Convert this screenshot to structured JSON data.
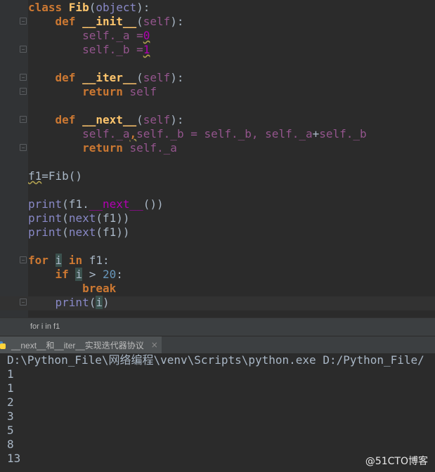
{
  "editor": {
    "lines": [
      [
        {
          "t": "class ",
          "c": "kw"
        },
        {
          "t": "Fib",
          "c": "fn"
        },
        {
          "t": "(",
          "c": "plain"
        },
        {
          "t": "object",
          "c": "builtin"
        },
        {
          "t": "):",
          "c": "plain"
        }
      ],
      [
        {
          "t": "    "
        },
        {
          "t": "def ",
          "c": "kw"
        },
        {
          "t": "__init__",
          "c": "fn"
        },
        {
          "t": "(",
          "c": "plain"
        },
        {
          "t": "self",
          "c": "selfc"
        },
        {
          "t": "):",
          "c": "plain"
        }
      ],
      [
        {
          "t": "        "
        },
        {
          "t": "self",
          "c": "selfc"
        },
        {
          "t": "._a =",
          "c": "selfc"
        },
        {
          "t": "0",
          "c": "mag wavy"
        }
      ],
      [
        {
          "t": "        "
        },
        {
          "t": "self",
          "c": "selfc"
        },
        {
          "t": "._b =",
          "c": "selfc"
        },
        {
          "t": "1",
          "c": "mag wavy"
        }
      ],
      [
        {
          "t": ""
        }
      ],
      [
        {
          "t": "    "
        },
        {
          "t": "def ",
          "c": "kw"
        },
        {
          "t": "__iter__",
          "c": "fn"
        },
        {
          "t": "(",
          "c": "plain"
        },
        {
          "t": "self",
          "c": "selfc"
        },
        {
          "t": "):",
          "c": "plain"
        }
      ],
      [
        {
          "t": "        "
        },
        {
          "t": "return ",
          "c": "kw"
        },
        {
          "t": "self",
          "c": "selfc"
        }
      ],
      [
        {
          "t": ""
        }
      ],
      [
        {
          "t": "    "
        },
        {
          "t": "def ",
          "c": "kw"
        },
        {
          "t": "__next__",
          "c": "fn"
        },
        {
          "t": "(",
          "c": "plain"
        },
        {
          "t": "self",
          "c": "selfc"
        },
        {
          "t": "):",
          "c": "plain"
        }
      ],
      [
        {
          "t": "        "
        },
        {
          "t": "self",
          "c": "selfc"
        },
        {
          "t": "._a",
          "c": "selfc"
        },
        {
          "t": ",",
          "c": "kw wavy"
        },
        {
          "t": "self",
          "c": "selfc"
        },
        {
          "t": "._b = ",
          "c": "selfc"
        },
        {
          "t": "self",
          "c": "selfc"
        },
        {
          "t": "._b, ",
          "c": "selfc"
        },
        {
          "t": "self",
          "c": "selfc"
        },
        {
          "t": "._a",
          "c": "selfc"
        },
        {
          "t": "+",
          "c": "plain"
        },
        {
          "t": "self",
          "c": "selfc"
        },
        {
          "t": "._b",
          "c": "selfc"
        }
      ],
      [
        {
          "t": "        "
        },
        {
          "t": "return ",
          "c": "kw"
        },
        {
          "t": "self",
          "c": "selfc"
        },
        {
          "t": "._a",
          "c": "selfc"
        }
      ],
      [
        {
          "t": ""
        }
      ],
      [
        {
          "t": "f1",
          "c": "plain wavy"
        },
        {
          "t": "=Fib()",
          "c": "plain"
        }
      ],
      [
        {
          "t": ""
        }
      ],
      [
        {
          "t": "print",
          "c": "builtin"
        },
        {
          "t": "(f1.",
          "c": "plain"
        },
        {
          "t": "__next__",
          "c": "dunder"
        },
        {
          "t": "())",
          "c": "plain"
        }
      ],
      [
        {
          "t": "print",
          "c": "builtin"
        },
        {
          "t": "(",
          "c": "plain"
        },
        {
          "t": "next",
          "c": "builtin"
        },
        {
          "t": "(f1))",
          "c": "plain"
        }
      ],
      [
        {
          "t": "print",
          "c": "builtin"
        },
        {
          "t": "(",
          "c": "plain"
        },
        {
          "t": "next",
          "c": "builtin"
        },
        {
          "t": "(f1))",
          "c": "plain"
        }
      ],
      [
        {
          "t": ""
        }
      ],
      [
        {
          "t": "for ",
          "c": "kw"
        },
        {
          "t": "i",
          "c": "plain varhl"
        },
        {
          "t": " in ",
          "c": "kw"
        },
        {
          "t": "f1:",
          "c": "plain"
        }
      ],
      [
        {
          "t": "    "
        },
        {
          "t": "if ",
          "c": "kw"
        },
        {
          "t": "i",
          "c": "plain varhl"
        },
        {
          "t": " > ",
          "c": "plain"
        },
        {
          "t": "20",
          "c": "num"
        },
        {
          "t": ":",
          "c": "plain"
        }
      ],
      [
        {
          "t": "        "
        },
        {
          "t": "break",
          "c": "kw"
        }
      ],
      [
        {
          "t": "    "
        },
        {
          "t": "print",
          "c": "builtin"
        },
        {
          "t": "(",
          "c": "plain"
        },
        {
          "t": "i",
          "c": "plain varhl"
        },
        {
          "t": ")",
          "c": "plain"
        }
      ]
    ]
  },
  "breadcrumb": "for i in f1",
  "run_tab": {
    "label": "__next__和__iter__实现迭代器协议",
    "close": "×"
  },
  "console": {
    "lines": [
      "D:\\Python_File\\网络编程\\venv\\Scripts\\python.exe D:/Python_File/",
      "1",
      "1",
      "2",
      "3",
      "5",
      "8",
      "13"
    ]
  },
  "watermark": "@51CTO博客"
}
